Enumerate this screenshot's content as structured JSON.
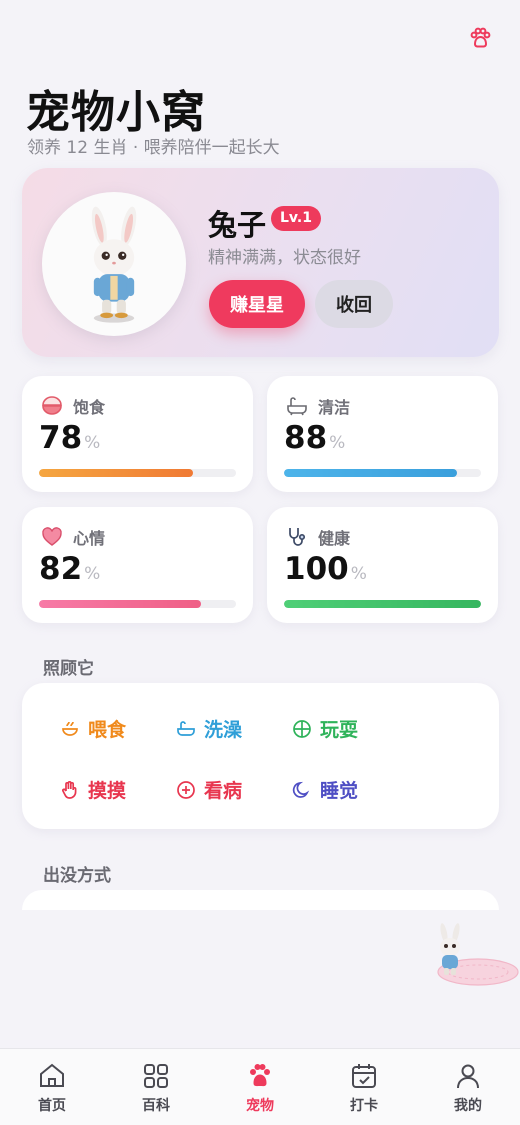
{
  "header": {
    "title": "宠物小窝",
    "subtitle": "领养 12 生肖 · 喂养陪伴一起长大",
    "top_icon": "paw-icon"
  },
  "pet": {
    "name": "兔子",
    "level": "Lv.1",
    "status": "精神满满，状态很好",
    "earn_label": "赚星星",
    "recall_label": "收回"
  },
  "stats": [
    {
      "label": "饱食",
      "value": "78",
      "unit": "%",
      "level": 0.78,
      "icon": "rice-bowl-icon",
      "color": "#f08a3a"
    },
    {
      "label": "清洁",
      "value": "88",
      "unit": "%",
      "level": 0.88,
      "icon": "bathtub-icon",
      "color": "#3aa6e0"
    },
    {
      "label": "心情",
      "value": "82",
      "unit": "%",
      "level": 0.82,
      "icon": "heart-icon",
      "color": "#f2668f"
    },
    {
      "label": "健康",
      "value": "100",
      "unit": "%",
      "level": 1.0,
      "icon": "stethoscope-icon",
      "color": "#3cc068"
    }
  ],
  "care": {
    "title": "照顾它",
    "actions": [
      {
        "label": "喂食",
        "icon": "bowl-icon",
        "color": "#f08a1c"
      },
      {
        "label": "洗澡",
        "icon": "bath-icon",
        "color": "#2f9fd8"
      },
      {
        "label": "玩耍",
        "icon": "ball-icon",
        "color": "#2fb35a"
      },
      {
        "label": "摸摸",
        "icon": "hand-icon",
        "color": "#e8364f"
      },
      {
        "label": "看病",
        "icon": "medical-cross-icon",
        "color": "#e8364f"
      },
      {
        "label": "睡觉",
        "icon": "moon-icon",
        "color": "#4f4fc4"
      }
    ]
  },
  "appearance": {
    "title": "出没方式"
  },
  "tabs": [
    {
      "label": "首页",
      "icon": "home-icon",
      "active": false
    },
    {
      "label": "百科",
      "icon": "grid-icon",
      "active": false
    },
    {
      "label": "宠物",
      "icon": "paw-icon",
      "active": true
    },
    {
      "label": "打卡",
      "icon": "calendar-check-icon",
      "active": false
    },
    {
      "label": "我的",
      "icon": "user-icon",
      "active": false
    }
  ],
  "colors": {
    "accent": "#ee3a5c",
    "background": "#f4f3f8"
  }
}
